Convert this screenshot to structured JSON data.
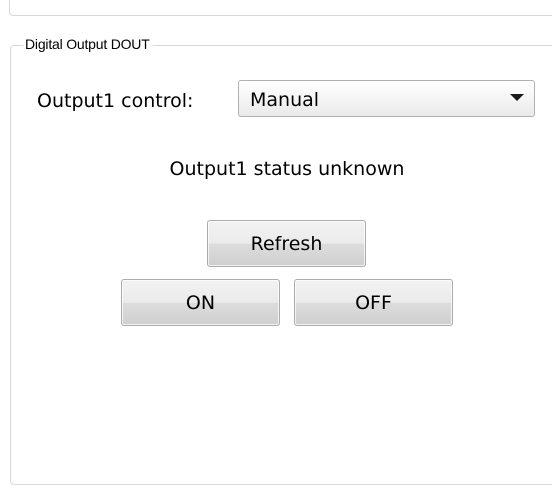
{
  "group": {
    "title": "Digital Output DOUT"
  },
  "output_control": {
    "label": "Output1 control:",
    "selected": "Manual"
  },
  "status": {
    "text": "Output1 status unknown"
  },
  "buttons": {
    "refresh": "Refresh",
    "on": "ON",
    "off": "OFF"
  },
  "icons": {
    "dropdown": "chevron-down-icon"
  }
}
